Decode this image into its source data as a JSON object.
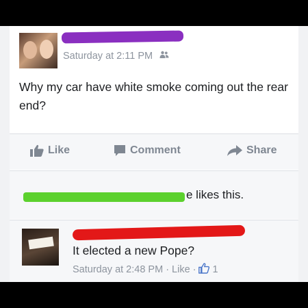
{
  "post": {
    "timestamp": "Saturday at 2:11 PM",
    "audience_icon": "friends-icon",
    "text": "Why  my car have white smoke coming out the rear end?"
  },
  "actions": {
    "like_label": "Like",
    "comment_label": "Comment",
    "share_label": "Share"
  },
  "likes": {
    "text": "e likes this."
  },
  "comment": {
    "text": "It elected a new Pope?",
    "timestamp": "Saturday at 2:48 PM",
    "separator": "·",
    "like_label": "Like",
    "like_count": "1"
  },
  "colors": {
    "redaction_name": "#8a2fc0",
    "redaction_likers": "#5cd12e",
    "redaction_commenter": "#e31818",
    "meta_gray": "#8d949e",
    "action_gray": "#7f8792"
  }
}
